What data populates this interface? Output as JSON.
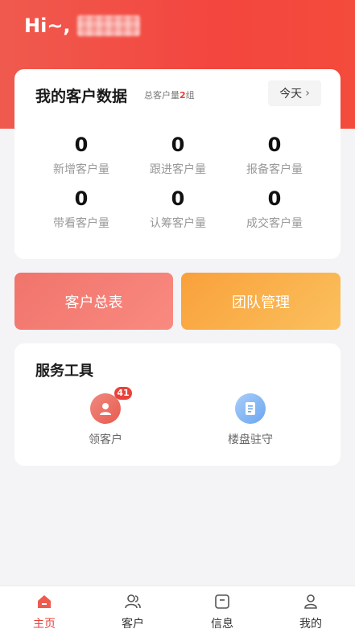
{
  "header": {
    "greeting": "Hi~,"
  },
  "stats": {
    "title": "我的客户数据",
    "total_prefix": "总客户量",
    "total_count": "2",
    "total_suffix": "组",
    "period_label": "今天",
    "items": [
      {
        "value": "0",
        "label": "新增客户量"
      },
      {
        "value": "0",
        "label": "跟进客户量"
      },
      {
        "value": "0",
        "label": "报备客户量"
      },
      {
        "value": "0",
        "label": "带看客户量"
      },
      {
        "value": "0",
        "label": "认筹客户量"
      },
      {
        "value": "0",
        "label": "成交客户量"
      }
    ]
  },
  "actions": {
    "customers_label": "客户总表",
    "team_label": "团队管理"
  },
  "tools": {
    "title": "服务工具",
    "items": [
      {
        "label": "领客户",
        "badge": "41",
        "icon": "user-icon"
      },
      {
        "label": "楼盘驻守",
        "icon": "document-icon"
      }
    ]
  },
  "tabbar": {
    "items": [
      {
        "label": "主页",
        "icon": "home-icon",
        "active": true
      },
      {
        "label": "客户",
        "icon": "users-icon"
      },
      {
        "label": "信息",
        "icon": "message-icon"
      },
      {
        "label": "我的",
        "icon": "profile-icon"
      }
    ]
  },
  "colors": {
    "brand_red": "#f3463f",
    "accent_red": "#e8423a",
    "customers_button": "#f0746c",
    "team_button": "#f9a13b"
  }
}
